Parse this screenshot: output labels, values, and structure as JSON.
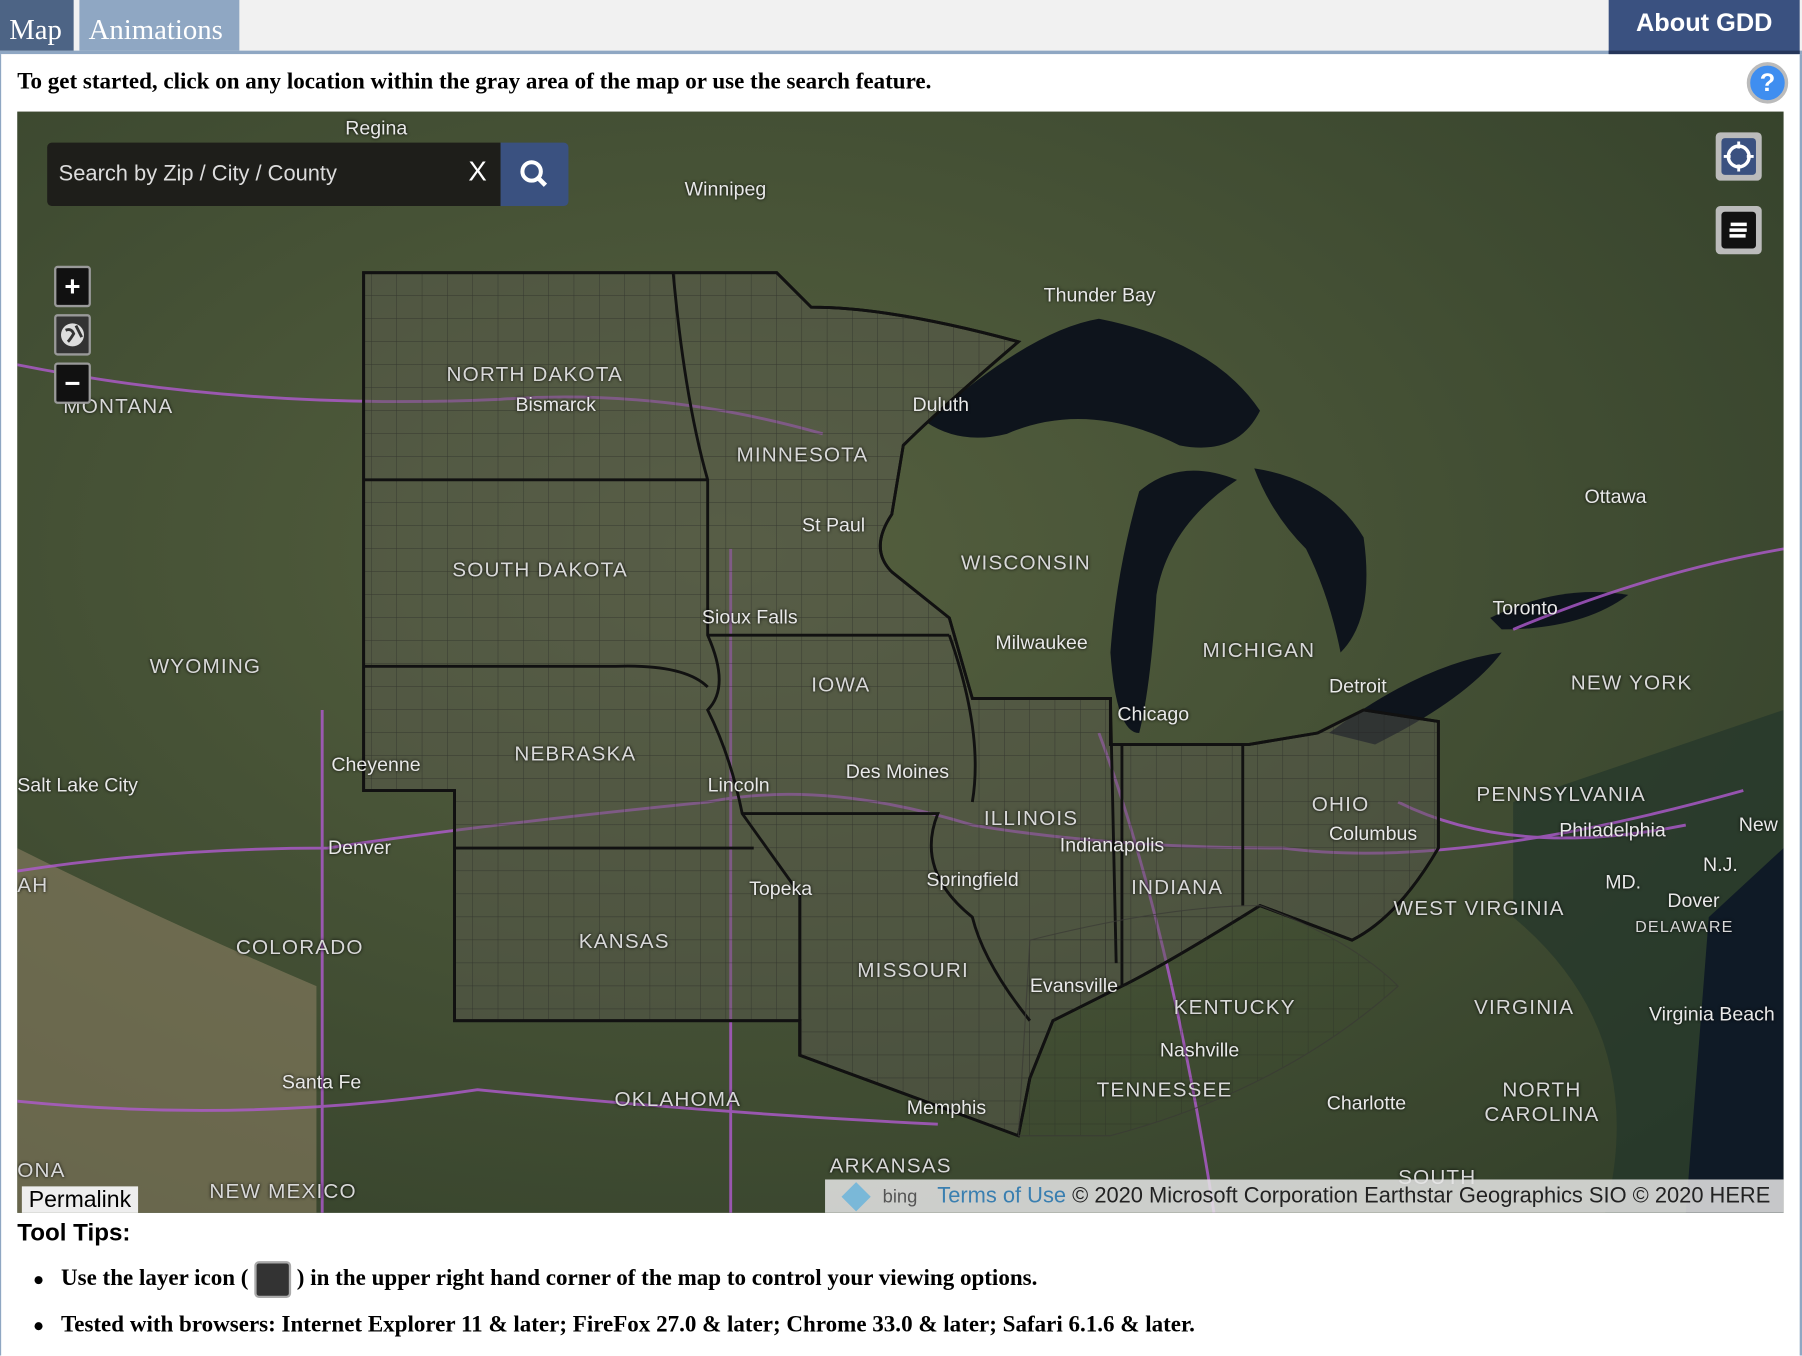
{
  "tabs": [
    {
      "label": "Map",
      "active": true
    },
    {
      "label": "Animations",
      "active": false
    }
  ],
  "about_button": "About GDD",
  "intro": "To get started, click on any location within the gray area of the map or use the search feature.",
  "help_icon": "?",
  "search": {
    "placeholder": "Search by Zip / City / County",
    "value": "",
    "clear_label": "X"
  },
  "map_controls": {
    "zoom_in": "+",
    "zoom_out": "−"
  },
  "map_labels": {
    "cities": [
      "Winnipeg",
      "Regina",
      "Thunder Bay",
      "Duluth",
      "Bismarck",
      "St Paul",
      "Sioux Falls",
      "Milwaukee",
      "Chicago",
      "Detroit",
      "Toronto",
      "Ottawa",
      "Des Moines",
      "Lincoln",
      "Cheyenne",
      "Denver",
      "Salt Lake City",
      "Topeka",
      "Springfield",
      "Indianapolis",
      "Columbus",
      "Philadelphia",
      "Dover",
      "Virginia Beach",
      "Evansville",
      "Nashville",
      "Memphis",
      "Charlotte",
      "Santa Fe",
      "New",
      "N.J.",
      "MD."
    ],
    "states": [
      "NORTH DAKOTA",
      "MONTANA",
      "MINNESOTA",
      "SOUTH DAKOTA",
      "WISCONSIN",
      "MICHIGAN",
      "WYOMING",
      "IOWA",
      "NEBRASKA",
      "ILLINOIS",
      "INDIANA",
      "OHIO",
      "PENNSYLVANIA",
      "NEW YORK",
      "COLORADO",
      "KANSAS",
      "MISSOURI",
      "KENTUCKY",
      "WEST VIRGINIA",
      "VIRGINIA",
      "DELAWARE",
      "TENNESSEE",
      "NORTH CAROLINA",
      "OKLAHOMA",
      "ARKANSAS",
      "NEW MEXICO",
      "SOUTH",
      "AH",
      "ONA"
    ]
  },
  "permalink": "Permalink",
  "attribution": {
    "bing": "bing",
    "terms": "Terms of Use",
    "text": "© 2020 Microsoft Corporation Earthstar Geographics SIO © 2020 HERE"
  },
  "tool_tips": {
    "title": "Tool Tips:",
    "items": [
      {
        "before": "Use the layer icon (",
        "after": ") in the upper right hand corner of the map to control your viewing options."
      },
      {
        "before": "Tested with browsers: Internet Explorer 11 & later; FireFox 27.0 & later; Chrome 33.0 & later; Safari 6.1.6 & later.",
        "after": ""
      }
    ]
  },
  "colors": {
    "tab_active": "#4d6485",
    "tab_inactive": "#8fa7c3",
    "about_bg": "#3a5180",
    "help": "#3f8ef0",
    "terms_link": "#3a7fb0",
    "roads": "#b05ad0"
  }
}
